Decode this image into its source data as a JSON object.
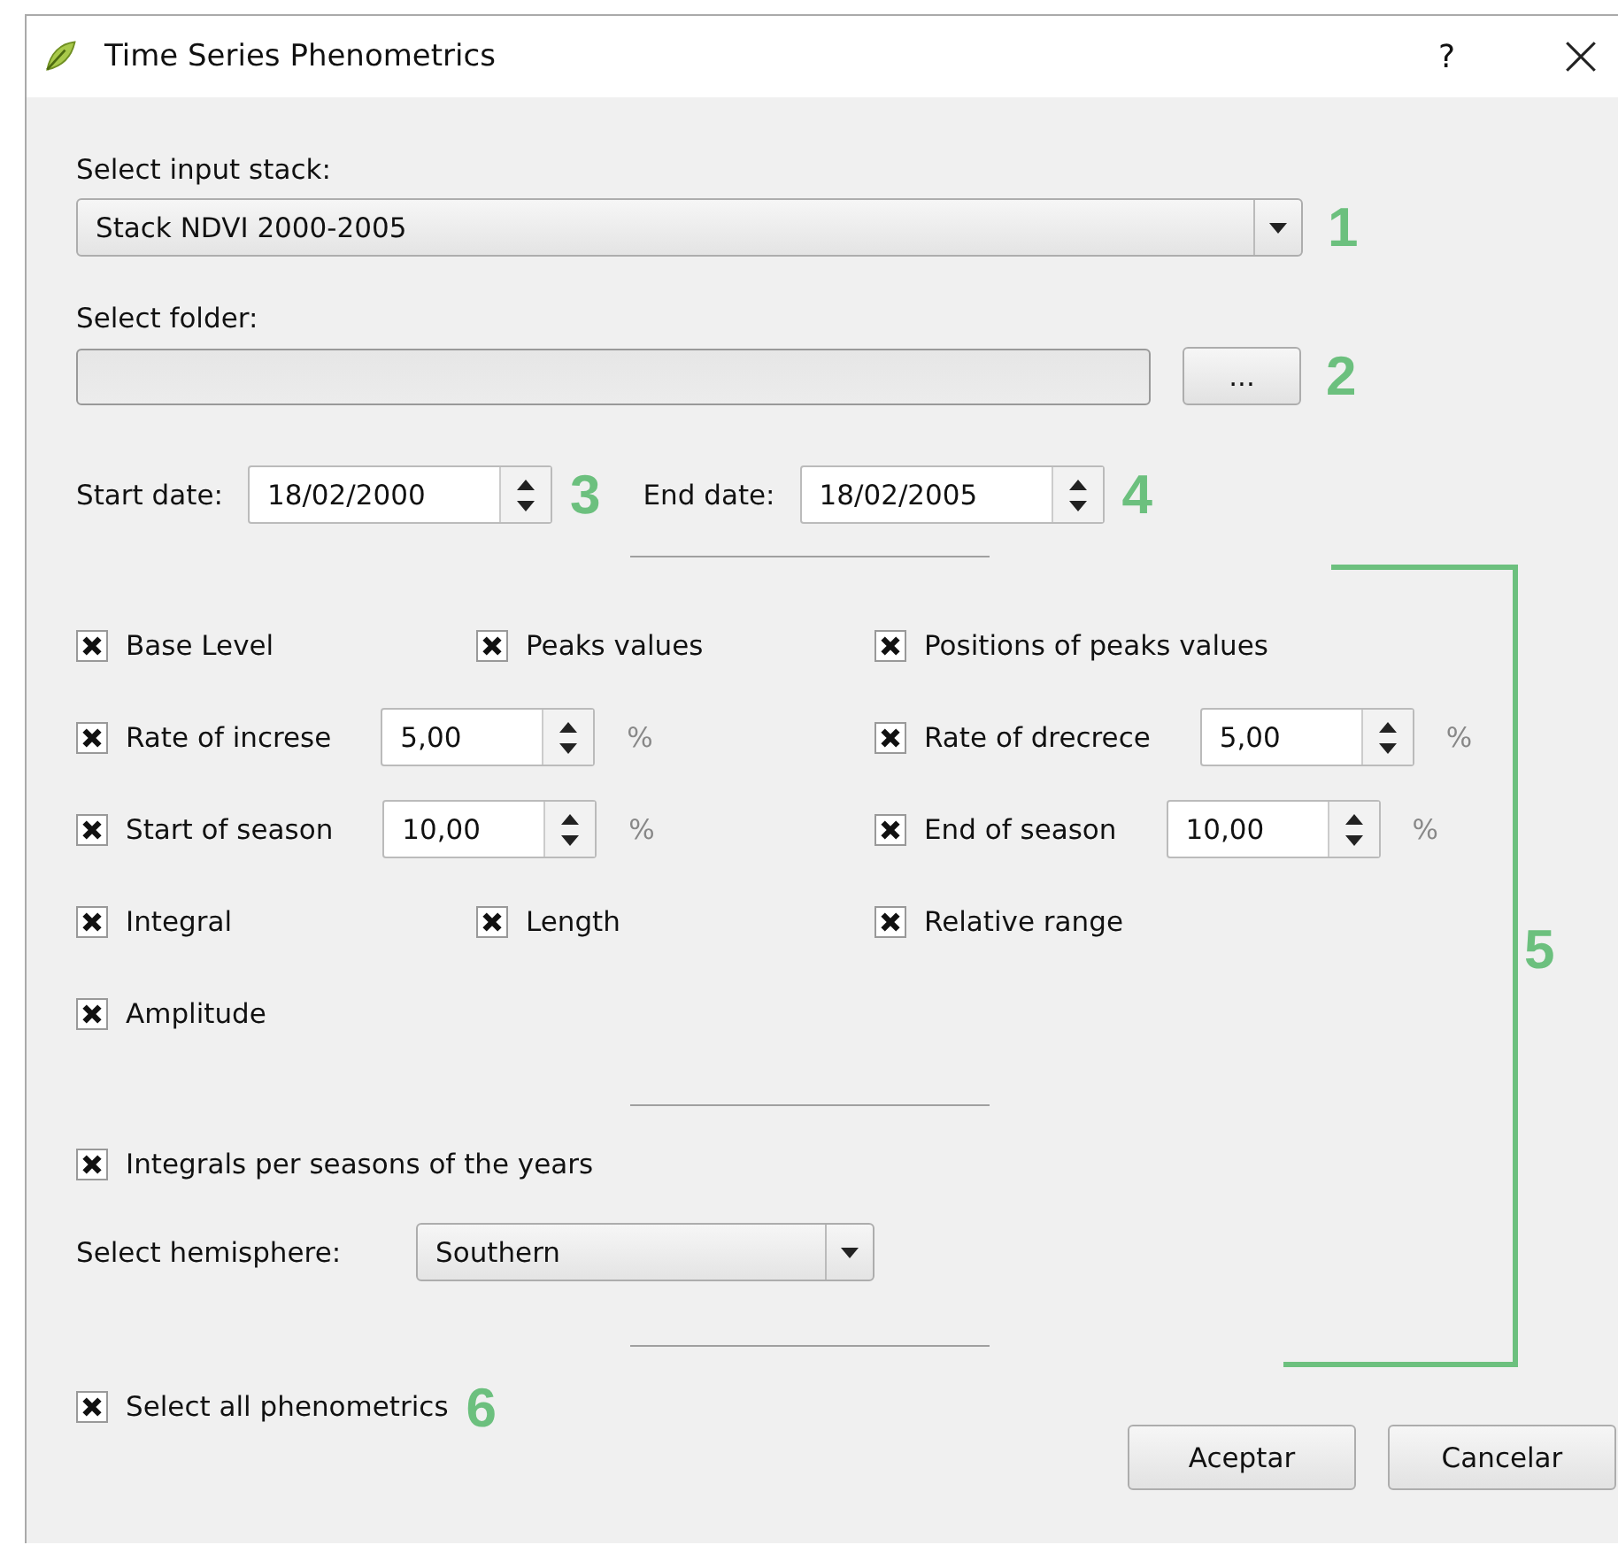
{
  "window": {
    "title": "Time Series Phenometrics",
    "help": "?"
  },
  "input_stack": {
    "label": "Select input stack:",
    "value": "Stack NDVI 2000-2005",
    "annotation": "1"
  },
  "folder": {
    "label": "Select folder:",
    "button": "...",
    "annotation": "2"
  },
  "dates": [
    {
      "label": "Start date:",
      "value": "18/02/2000",
      "annotation": "3"
    },
    {
      "label": "End date:",
      "value": "18/02/2005",
      "annotation": "4"
    }
  ],
  "options_annotation": "5",
  "options": [
    {
      "kind": "check",
      "label": "Base Level",
      "checked": true
    },
    {
      "kind": "check",
      "label": "Peaks values",
      "checked": true
    },
    {
      "kind": "check",
      "label": "Positions of peaks values",
      "checked": true
    },
    {
      "kind": "spin",
      "label": "Rate of increse",
      "checked": true,
      "value": "5,00",
      "unit": "%"
    },
    {
      "kind": "spin",
      "label": "Rate of drecrece",
      "checked": true,
      "value": "5,00",
      "unit": "%"
    },
    {
      "kind": "spin",
      "label": "Start of season",
      "checked": true,
      "value": "10,00",
      "unit": "%"
    },
    {
      "kind": "spin",
      "label": "End of season",
      "checked": true,
      "value": "10,00",
      "unit": "%"
    },
    {
      "kind": "check",
      "label": "Integral",
      "checked": true
    },
    {
      "kind": "check",
      "label": "Length",
      "checked": true
    },
    {
      "kind": "check",
      "label": "Relative range",
      "checked": true
    },
    {
      "kind": "check",
      "label": "Amplitude",
      "checked": true
    }
  ],
  "integrals_per_season": {
    "label": "Integrals per seasons of the years",
    "checked": true
  },
  "hemisphere": {
    "label": "Select hemisphere:",
    "value": "Southern"
  },
  "select_all": {
    "label": "Select all phenometrics",
    "checked": true,
    "annotation": "6"
  },
  "buttons": [
    "Aceptar",
    "Cancelar"
  ]
}
